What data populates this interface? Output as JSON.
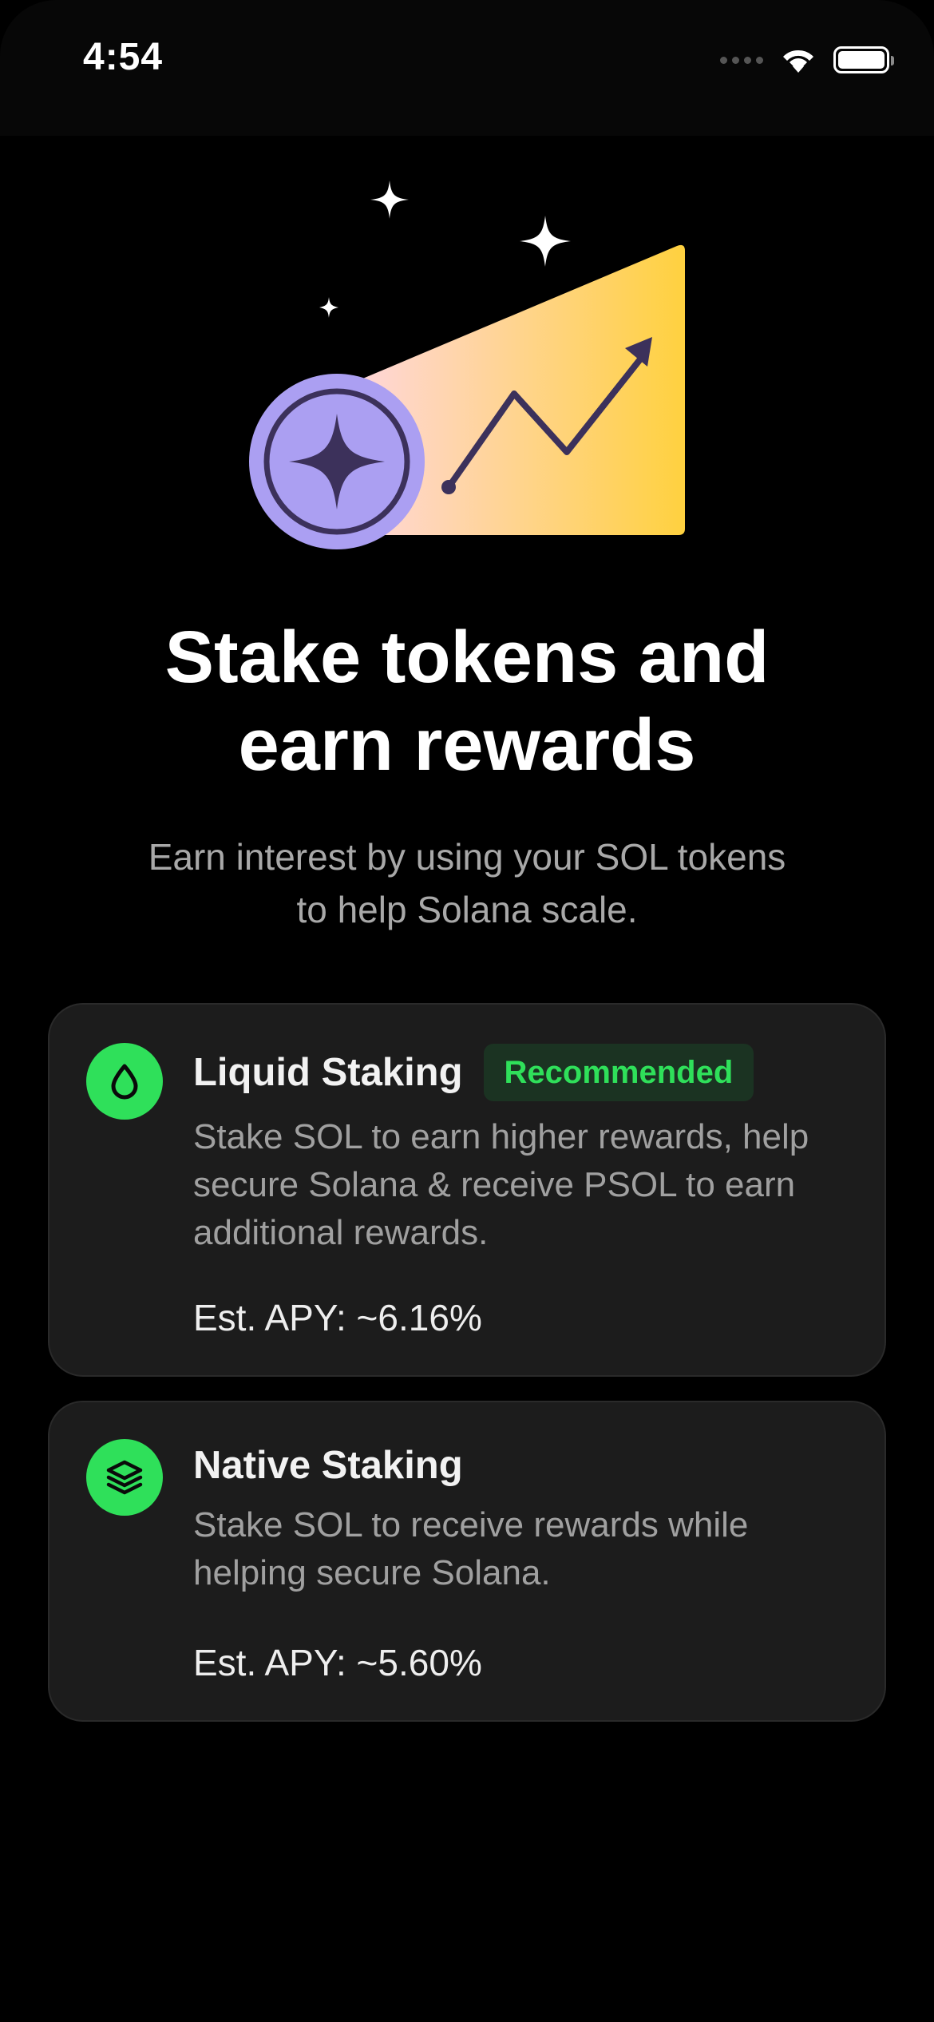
{
  "status_bar": {
    "time": "4:54",
    "icons": [
      "cellular-signal-icon",
      "wifi-icon",
      "battery-icon"
    ]
  },
  "hero": {
    "icons": [
      "sparkle-icon",
      "coin-icon",
      "trend-up-arrow-icon"
    ],
    "colors": {
      "coin": "#ab9ff2",
      "coin_dark": "#3c315b",
      "gradient_start": "#ffd7e8",
      "gradient_end": "#ffd13f",
      "sparkle": "#ffffff"
    }
  },
  "headline": {
    "line1": "Stake tokens and",
    "line2": "earn rewards"
  },
  "subtitle": {
    "line1": "Earn interest by using your SOL tokens",
    "line2": "to help Solana scale."
  },
  "options": [
    {
      "title": "Liquid Staking",
      "badge": "Recommended",
      "description": [
        "Stake SOL to earn higher rewards, help",
        "secure Solana & receive PSOL to earn",
        "additional rewards."
      ],
      "apy": "Est. APY: ~6.16%",
      "icon": "droplet-icon"
    },
    {
      "title": "Native Staking",
      "description": [
        "Stake SOL to receive rewards while",
        "helping secure Solana."
      ],
      "apy": "Est. APY: ~5.60%",
      "icon": "layers-icon"
    }
  ],
  "colors": {
    "background": "#000000",
    "card": "#1c1c1c",
    "accent_green": "#2fe05a",
    "badge_bg": "#1b3322",
    "text_primary": "#ffffff",
    "text_secondary": "#a0a0a0"
  }
}
